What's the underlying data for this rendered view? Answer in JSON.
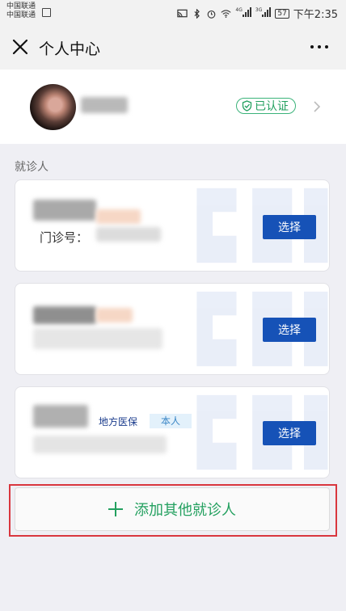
{
  "status_bar": {
    "carrier_1": "中国联通",
    "carrier_2": "中国联通",
    "network_1": "4G",
    "network_2": "3G",
    "battery": "57",
    "time": "下午2:35"
  },
  "header": {
    "title": "个人中心",
    "close_icon": "close-icon",
    "more_icon": "more-icon"
  },
  "profile": {
    "verified_label": "已认证"
  },
  "patients_section": {
    "label": "就诊人",
    "cards": [
      {
        "clinic_number_label": "门诊号：",
        "select_label": "选择"
      },
      {
        "select_label": "选择"
      },
      {
        "insurance_tag": "地方医保",
        "relation_tag": "本人",
        "select_label": "选择"
      }
    ]
  },
  "add_patient": {
    "label": "添加其他就诊人"
  },
  "colors": {
    "accent_green": "#23a05f",
    "select_button_blue": "#1652b7",
    "highlight_red": "#d9363e"
  }
}
